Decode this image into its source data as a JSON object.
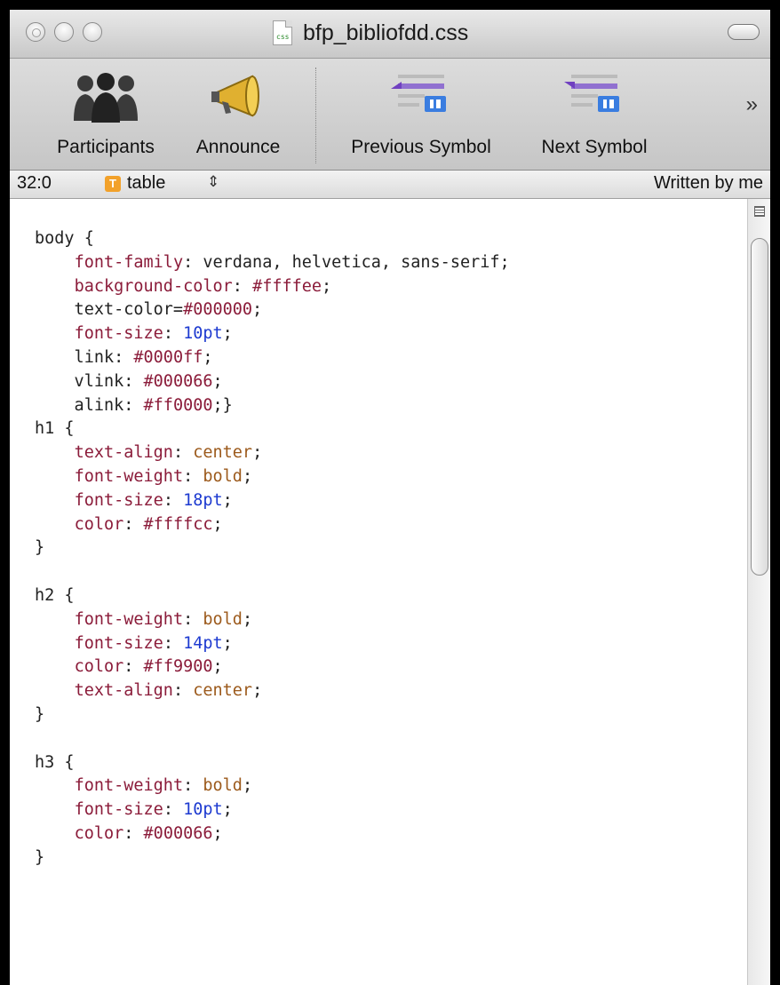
{
  "window": {
    "title": "bfp_bibliofdd.css",
    "file_icon_text": "css"
  },
  "toolbar": {
    "items": [
      {
        "label": "Participants",
        "icon": "participants-icon"
      },
      {
        "label": "Announce",
        "icon": "megaphone-icon"
      },
      {
        "label": "Previous Symbol",
        "icon": "previous-symbol-icon"
      },
      {
        "label": "Next Symbol",
        "icon": "next-symbol-icon"
      }
    ],
    "overflow": "»"
  },
  "statusbar": {
    "position": "32:0",
    "symbol_badge": "T",
    "symbol": "table",
    "symbol_arrows": "⇕",
    "author": "Written by me"
  },
  "code": {
    "lines": [
      [
        {
          "t": "body {",
          "c": "plain"
        }
      ],
      [
        {
          "t": "    ",
          "c": "plain"
        },
        {
          "t": "font-family",
          "c": "prop"
        },
        {
          "t": ": verdana, helvetica, sans-serif;",
          "c": "plain"
        }
      ],
      [
        {
          "t": "    ",
          "c": "plain"
        },
        {
          "t": "background-color",
          "c": "prop"
        },
        {
          "t": ": ",
          "c": "plain"
        },
        {
          "t": "#ffffee",
          "c": "hex"
        },
        {
          "t": ";",
          "c": "plain"
        }
      ],
      [
        {
          "t": "    text-color=",
          "c": "plain"
        },
        {
          "t": "#000000",
          "c": "hex"
        },
        {
          "t": ";",
          "c": "plain"
        }
      ],
      [
        {
          "t": "    ",
          "c": "plain"
        },
        {
          "t": "font-size",
          "c": "prop"
        },
        {
          "t": ": ",
          "c": "plain"
        },
        {
          "t": "10pt",
          "c": "num"
        },
        {
          "t": ";",
          "c": "plain"
        }
      ],
      [
        {
          "t": "    link: ",
          "c": "plain"
        },
        {
          "t": "#0000ff",
          "c": "hex"
        },
        {
          "t": ";",
          "c": "plain"
        }
      ],
      [
        {
          "t": "    vlink: ",
          "c": "plain"
        },
        {
          "t": "#000066",
          "c": "hex"
        },
        {
          "t": ";",
          "c": "plain"
        }
      ],
      [
        {
          "t": "    alink: ",
          "c": "plain"
        },
        {
          "t": "#ff0000",
          "c": "hex"
        },
        {
          "t": ";}",
          "c": "plain"
        }
      ],
      [
        {
          "t": "h1 {",
          "c": "plain"
        }
      ],
      [
        {
          "t": "    ",
          "c": "plain"
        },
        {
          "t": "text-align",
          "c": "prop"
        },
        {
          "t": ": ",
          "c": "plain"
        },
        {
          "t": "center",
          "c": "kw"
        },
        {
          "t": ";",
          "c": "plain"
        }
      ],
      [
        {
          "t": "    ",
          "c": "plain"
        },
        {
          "t": "font-weight",
          "c": "prop"
        },
        {
          "t": ": ",
          "c": "plain"
        },
        {
          "t": "bold",
          "c": "kw"
        },
        {
          "t": ";",
          "c": "plain"
        }
      ],
      [
        {
          "t": "    ",
          "c": "plain"
        },
        {
          "t": "font-size",
          "c": "prop"
        },
        {
          "t": ": ",
          "c": "plain"
        },
        {
          "t": "18pt",
          "c": "num"
        },
        {
          "t": ";",
          "c": "plain"
        }
      ],
      [
        {
          "t": "    ",
          "c": "plain"
        },
        {
          "t": "color",
          "c": "prop"
        },
        {
          "t": ": ",
          "c": "plain"
        },
        {
          "t": "#ffffcc",
          "c": "hex"
        },
        {
          "t": ";",
          "c": "plain"
        }
      ],
      [
        {
          "t": "}",
          "c": "plain"
        }
      ],
      [
        {
          "t": "",
          "c": "plain"
        }
      ],
      [
        {
          "t": "h2 {",
          "c": "plain"
        }
      ],
      [
        {
          "t": "    ",
          "c": "plain"
        },
        {
          "t": "font-weight",
          "c": "prop"
        },
        {
          "t": ": ",
          "c": "plain"
        },
        {
          "t": "bold",
          "c": "kw"
        },
        {
          "t": ";",
          "c": "plain"
        }
      ],
      [
        {
          "t": "    ",
          "c": "plain"
        },
        {
          "t": "font-size",
          "c": "prop"
        },
        {
          "t": ": ",
          "c": "plain"
        },
        {
          "t": "14pt",
          "c": "num"
        },
        {
          "t": ";",
          "c": "plain"
        }
      ],
      [
        {
          "t": "    ",
          "c": "plain"
        },
        {
          "t": "color",
          "c": "prop"
        },
        {
          "t": ": ",
          "c": "plain"
        },
        {
          "t": "#ff9900",
          "c": "hex"
        },
        {
          "t": ";",
          "c": "plain"
        }
      ],
      [
        {
          "t": "    ",
          "c": "plain"
        },
        {
          "t": "text-align",
          "c": "prop"
        },
        {
          "t": ": ",
          "c": "plain"
        },
        {
          "t": "center",
          "c": "kw"
        },
        {
          "t": ";",
          "c": "plain"
        }
      ],
      [
        {
          "t": "}",
          "c": "plain"
        }
      ],
      [
        {
          "t": "",
          "c": "plain"
        }
      ],
      [
        {
          "t": "h3 {",
          "c": "plain"
        }
      ],
      [
        {
          "t": "    ",
          "c": "plain"
        },
        {
          "t": "font-weight",
          "c": "prop"
        },
        {
          "t": ": ",
          "c": "plain"
        },
        {
          "t": "bold",
          "c": "kw"
        },
        {
          "t": ";",
          "c": "plain"
        }
      ],
      [
        {
          "t": "    ",
          "c": "plain"
        },
        {
          "t": "font-size",
          "c": "prop"
        },
        {
          "t": ": ",
          "c": "plain"
        },
        {
          "t": "10pt",
          "c": "num"
        },
        {
          "t": ";",
          "c": "plain"
        }
      ],
      [
        {
          "t": "    ",
          "c": "plain"
        },
        {
          "t": "color",
          "c": "prop"
        },
        {
          "t": ": ",
          "c": "plain"
        },
        {
          "t": "#000066",
          "c": "hex"
        },
        {
          "t": ";",
          "c": "plain"
        }
      ],
      [
        {
          "t": "}",
          "c": "plain"
        }
      ]
    ]
  },
  "colors": {
    "property": "#8b1c3a",
    "number": "#1d3ad0",
    "keyword": "#9c5a1c",
    "symbol_badge": "#f2a12a"
  }
}
